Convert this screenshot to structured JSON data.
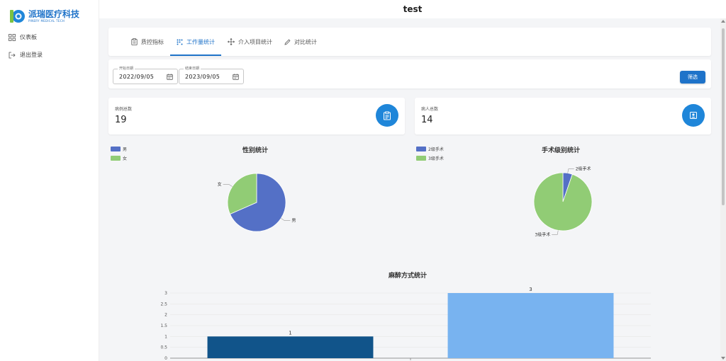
{
  "app": {
    "title": "test",
    "brand_name": "派瑞医疗科技",
    "brand_sub": "PINERY MEDICAL TECH"
  },
  "sidebar": {
    "items": [
      {
        "label": "仪表板",
        "icon": "dashboard-icon"
      },
      {
        "label": "退出登录",
        "icon": "logout-icon"
      }
    ]
  },
  "tabs": [
    {
      "label": "质控指标",
      "icon": "clipboard-icon",
      "active": false
    },
    {
      "label": "工作量统计",
      "icon": "grid-dots-icon",
      "active": true
    },
    {
      "label": "介入项目统计",
      "icon": "move-icon",
      "active": false
    },
    {
      "label": "对比统计",
      "icon": "pencil-icon",
      "active": false
    }
  ],
  "filter": {
    "start_label": "开始日期",
    "start_value": "2022/09/05",
    "end_label": "结束日期",
    "end_value": "2023/09/05",
    "button_label": "筛选"
  },
  "stats": [
    {
      "label": "病例总数",
      "value": "19",
      "icon": "clipboard-icon"
    },
    {
      "label": "病人总数",
      "value": "14",
      "icon": "person-badge-icon"
    }
  ],
  "colors": {
    "primary": "#1f73c9",
    "blue_slice": "#5470c6",
    "green_slice": "#91cc75",
    "dark_bar": "#11548a",
    "light_bar": "#78b3f0"
  },
  "chart_data": [
    {
      "type": "pie",
      "title": "性别统计",
      "categories": [
        "男",
        "女"
      ],
      "values": [
        13,
        6
      ],
      "colors": [
        "#5470c6",
        "#91cc75"
      ],
      "legend": "top-left"
    },
    {
      "type": "pie",
      "title": "手术级别统计",
      "categories": [
        "2级手术",
        "3级手术"
      ],
      "values": [
        1,
        18
      ],
      "colors": [
        "#5470c6",
        "#91cc75"
      ],
      "legend": "top-left"
    },
    {
      "type": "bar",
      "title": "麻醉方式统计",
      "categories": [
        "",
        ""
      ],
      "values": [
        1,
        3
      ],
      "colors": [
        "#11548a",
        "#78b3f0"
      ],
      "ylim": [
        0,
        3
      ],
      "yticks": [
        "0",
        "0.5",
        "1",
        "1.5",
        "2",
        "2.5",
        "3"
      ],
      "grid": true
    }
  ]
}
